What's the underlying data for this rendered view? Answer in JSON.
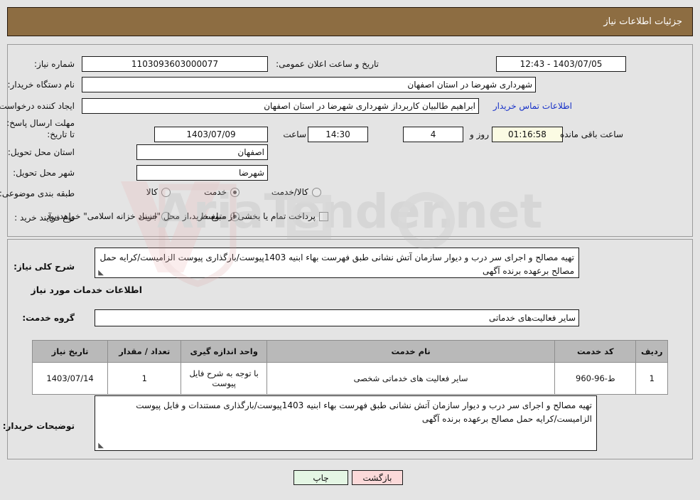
{
  "header": {
    "title": "جزئیات اطلاعات نیاز"
  },
  "form": {
    "need_number_label": "شماره نیاز:",
    "need_number_value": "1103093603000077",
    "buyer_org_label": "نام دستگاه خریدار:",
    "buyer_org_value": "شهرداری شهرضا در استان اصفهان",
    "requester_label": "ایجاد کننده درخواست:",
    "requester_value": "ابراهیم طالبیان کاربرداز شهرداری شهرضا در استان اصفهان",
    "deadline_label": "مهلت ارسال پاسخ: تا تاریخ:",
    "deadline_date": "1403/07/09",
    "province_label": "استان محل تحویل:",
    "province_value": "اصفهان",
    "city_label": "شهر محل تحویل:",
    "city_value": "شهرضا",
    "category_label": "طبقه بندی موضوعی:",
    "process_type_label": "نوع فرآیند خرید :",
    "announce_label": "تاریخ و ساعت اعلان عمومی:",
    "announce_value": "1403/07/05 - 12:43",
    "contact_link": "اطلاعات تماس خریدار",
    "hour_label": "ساعت",
    "hour_value": "14:30",
    "days_value": "4",
    "days_label": "روز و",
    "countdown_value": "01:16:58",
    "countdown_label": "ساعت باقی مانده",
    "category_options": [
      {
        "label": "کالا",
        "selected": false
      },
      {
        "label": "خدمت",
        "selected": true
      },
      {
        "label": "کالا/خدمت",
        "selected": false
      }
    ],
    "process_options": [
      {
        "label": "جزیی",
        "selected": false
      },
      {
        "label": "متوسط",
        "selected": true
      }
    ],
    "treasury_checkbox_label": "پرداخت تمام یا بخشی از مبلغ خرید،از محل \"اسناد خزانه اسلامی\" خواهد بود.",
    "treasury_checked": false
  },
  "description": {
    "label": "شرح کلی نیاز:",
    "value": "تهیه مصالح و اجرای سر درب و دیوار سازمان آتش نشانی طبق فهرست بهاء ابنیه 1403پیوست/بارگذاری پیوست الزامیست/کرایه حمل مصالح برعهده برنده آگهی"
  },
  "services_section": {
    "heading": "اطلاعات خدمات مورد نیاز",
    "group_label": "گروه خدمت:",
    "group_value": "سایر فعالیت‌های خدماتی"
  },
  "table": {
    "headers": [
      "ردیف",
      "کد خدمت",
      "نام خدمت",
      "واحد اندازه گیری",
      "تعداد / مقدار",
      "تاریخ نیاز"
    ],
    "rows": [
      {
        "row_no": "1",
        "service_code": "ط-96-960",
        "service_name": "سایر فعالیت های خدماتی شخصی",
        "unit": "با توجه به شرح فایل پیوست",
        "quantity": "1",
        "need_date": "1403/07/14"
      }
    ]
  },
  "buyer_notes": {
    "label": "توضیحات خریدار:",
    "value": "تهیه مصالح و اجرای سر درب و دیوار سازمان آتش نشانی طبق فهرست بهاء ابنیه 1403پیوست/بارگذاری مستندات و فایل پیوست الزامیست/کرایه حمل مصالح برعهده برنده آگهی"
  },
  "buttons": {
    "print": "چاپ",
    "back": "بازگشت"
  },
  "watermark": {
    "text": "AriaTender.net"
  },
  "colors": {
    "header_bar": "#8d6d42",
    "page_bg": "#e4e4e4",
    "link": "#1731c8",
    "table_header": "#b9b9b9",
    "print_btn": "#e4f6e4",
    "back_btn": "#fbd9d9",
    "countdown_bg": "#fbfbe3"
  }
}
